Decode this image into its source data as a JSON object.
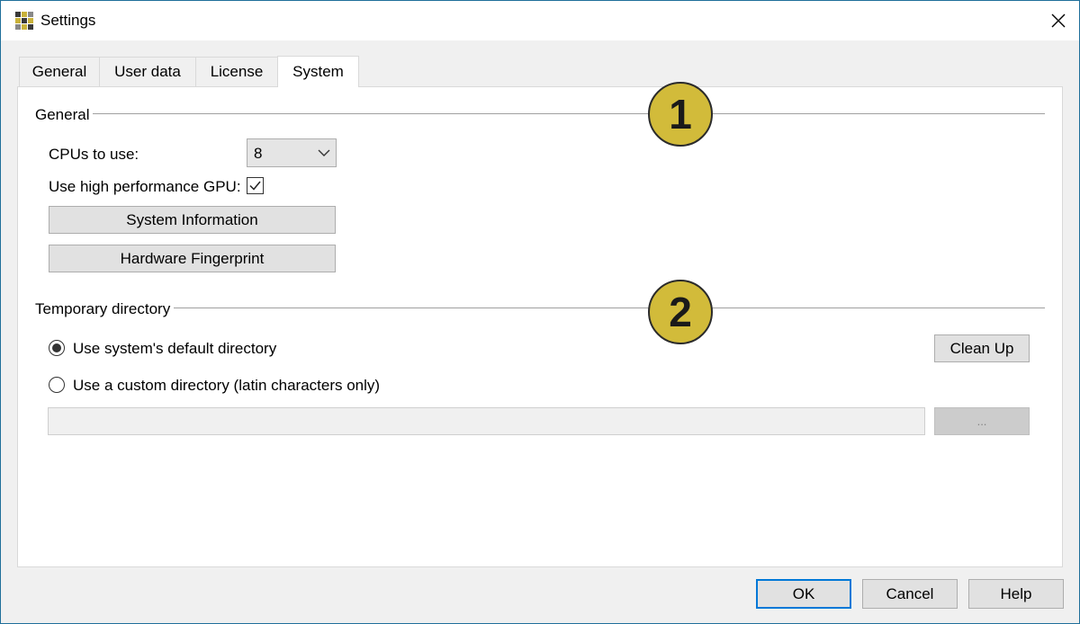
{
  "window": {
    "title": "Settings",
    "close_icon": "close-icon",
    "app_icon": "app-logo-icon"
  },
  "tabs": [
    {
      "label": "General",
      "active": false
    },
    {
      "label": "User data",
      "active": false
    },
    {
      "label": "License",
      "active": false
    },
    {
      "label": "System",
      "active": true
    }
  ],
  "general": {
    "heading": "General",
    "cpus_label": "CPUs to use:",
    "cpus_value": "8",
    "gpu_label": "Use high performance GPU:",
    "gpu_checked": true,
    "system_info_button": "System Information",
    "hardware_fingerprint_button": "Hardware Fingerprint"
  },
  "temp_dir": {
    "heading": "Temporary directory",
    "default_option": "Use system's default directory",
    "custom_option": "Use a custom directory (latin characters only)",
    "selected": "default",
    "path_value": "",
    "clean_up_button": "Clean Up",
    "browse_button": "..."
  },
  "annotations": [
    "1",
    "2"
  ],
  "footer": {
    "ok": "OK",
    "cancel": "Cancel",
    "help": "Help"
  },
  "colors": {
    "badge": "#d2bb3a",
    "default_button_border": "#0078d7",
    "window_border": "#1f6f9a"
  }
}
